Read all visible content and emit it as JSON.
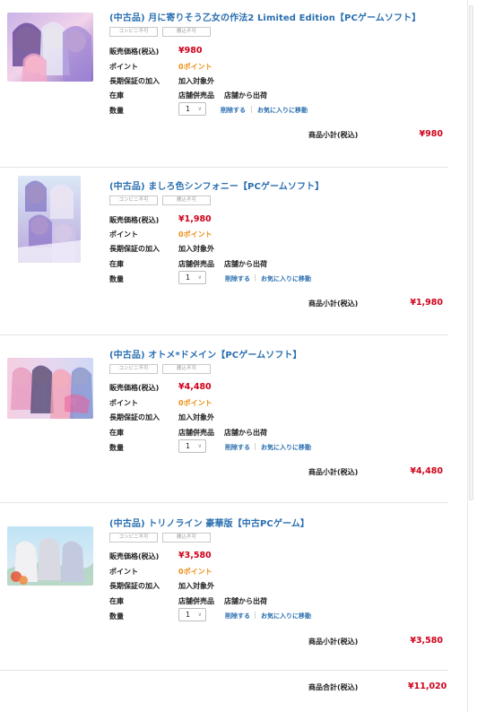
{
  "colors": {
    "title": "#2a6fb0",
    "price": "#d0021b",
    "point": "#ec8e12",
    "link": "#2a6fb0"
  },
  "labels": {
    "price": "販売価格(税込)",
    "point": "ポイント",
    "warranty": "長期保証の加入",
    "stock": "在庫",
    "quantity": "数量",
    "delete": "削除する",
    "favorite": "お気に入りに移動",
    "subtotal": "商品小計(税込)",
    "total": "商品合計(税込)"
  },
  "items": [
    {
      "title": "(中古品) 月に寄りそう乙女の作法2 Limited Edition【PCゲームソフト】",
      "badge1": "コンビニ不可",
      "badge2": "搬込不可",
      "price": "¥980",
      "point": "0ポイント",
      "warranty": "加入対象外",
      "stock_store": "店舗併売品",
      "stock_ship": "店舗から出荷",
      "quantity": "1",
      "subtotal": "¥980",
      "image_icon": "game-cover-art"
    },
    {
      "title": "(中古品) ましろ色シンフォニー【PCゲームソフト】",
      "badge1": "コンビニ不可",
      "badge2": "搬込不可",
      "price": "¥1,980",
      "point": "0ポイント",
      "warranty": "加入対象外",
      "stock_store": "店舗併売品",
      "stock_ship": "店舗から出荷",
      "quantity": "1",
      "subtotal": "¥1,980",
      "image_icon": "game-cover-art"
    },
    {
      "title": "(中古品) オトメ*ドメイン【PCゲームソフト】",
      "badge1": "コンビニ不可",
      "badge2": "搬込不可",
      "price": "¥4,480",
      "point": "0ポイント",
      "warranty": "加入対象外",
      "stock_store": "店舗併売品",
      "stock_ship": "店舗から出荷",
      "quantity": "1",
      "subtotal": "¥4,480",
      "image_icon": "game-cover-art"
    },
    {
      "title": "(中古品) トリノライン 豪華版【中古PCゲーム】",
      "badge1": "コンビニ不可",
      "badge2": "搬込不可",
      "price": "¥3,580",
      "point": "0ポイント",
      "warranty": "加入対象外",
      "stock_store": "店舗併売品",
      "stock_ship": "店舗から出荷",
      "quantity": "1",
      "subtotal": "¥3,580",
      "image_icon": "game-cover-art"
    }
  ],
  "total": "¥11,020"
}
